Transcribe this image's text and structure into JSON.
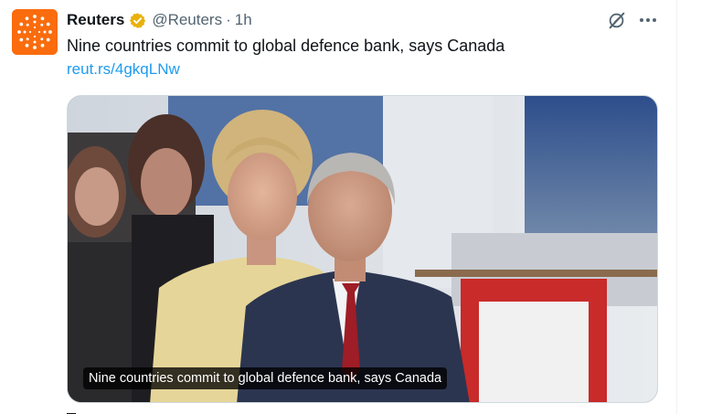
{
  "account": {
    "name": "Reuters",
    "handle": "@Reuters",
    "separator": "·",
    "time": "1h",
    "verified": true,
    "avatar_color": "#fa6c0d"
  },
  "tweet": {
    "text": "Nine countries commit to global defence bank, says Canada",
    "link": "reut.rs/4gkqLNw"
  },
  "media": {
    "caption": "Nine countries commit to global defence bank, says Canada"
  },
  "icons": {
    "grok": "grok-icon",
    "more": "more-dots-icon",
    "verified": "verified-badge-icon",
    "logo": "reuters-logo-icon"
  },
  "colors": {
    "link": "#1d9bf0",
    "verified_gold": "#e8b10c",
    "secondary_text": "#536471"
  }
}
